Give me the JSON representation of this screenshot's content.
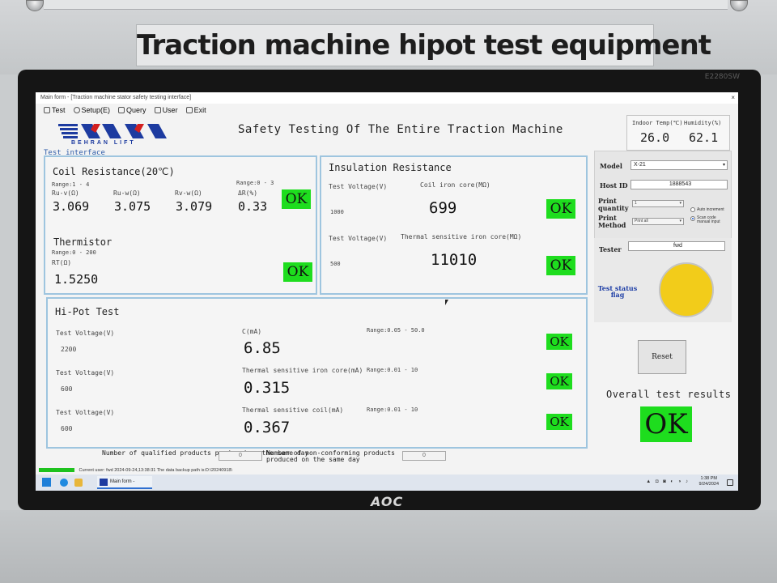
{
  "machine": {
    "title": "Traction  machine hipot  test equipment",
    "monitor_model": "E2280SW",
    "monitor_brand": "AOC"
  },
  "window": {
    "title": "Main form - [Traction machine stator safety testing interface]",
    "close_glyph": "×"
  },
  "menu": {
    "items": [
      {
        "label": "Test",
        "icon": "test-icon"
      },
      {
        "label": "Setup(E)",
        "icon": "gear-icon"
      },
      {
        "label": "Query",
        "icon": "query-icon"
      },
      {
        "label": "User",
        "icon": "user-icon"
      },
      {
        "label": "Exit",
        "icon": "exit-icon"
      }
    ]
  },
  "header": {
    "logo_sub": "BEHRAN LIFT",
    "app_title": "Safety Testing Of The Entire Traction Machine",
    "test_interface": "Test interface",
    "indoor_temp_label": "Indoor Temp(℃)",
    "indoor_temp": "26.0",
    "humidity_label": "Humidity(%)",
    "humidity": "62.1"
  },
  "coil": {
    "title": "Coil Resistance(20℃)",
    "range1": "Range:1 - 4",
    "range2": "Range:0 - 3",
    "labels": [
      "Ru-v(Ω)",
      "Ru-w(Ω)",
      "Rv-w(Ω)",
      "ΔR(%)"
    ],
    "values": [
      "3.069",
      "3.075",
      "3.079",
      "0.33"
    ],
    "result": "OK"
  },
  "thermistor": {
    "title": "Thermistor",
    "range": "Range:0 - 200",
    "label": "RT(Ω)",
    "value": "1.5250",
    "result": "OK"
  },
  "insulation": {
    "title": "Insulation Resistance",
    "rows": [
      {
        "voltage_label": "Test Voltage(V)",
        "voltage": "1000",
        "name": "Coil iron core(MΩ)",
        "value": "699",
        "result": "OK"
      },
      {
        "voltage_label": "Test Voltage(V)",
        "voltage": "500",
        "name": "Thermal sensitive iron core(MΩ)",
        "value": "11010",
        "result": "OK"
      }
    ]
  },
  "hipot": {
    "title": "Hi-Pot Test",
    "rows": [
      {
        "voltage_label": "Test Voltage(V)",
        "voltage": "2200",
        "name": "C(mA)",
        "range": "Range:0.05 - 50.0",
        "value": "6.85",
        "result": "OK"
      },
      {
        "voltage_label": "Test Voltage(V)",
        "voltage": "600",
        "name": "Thermal sensitive iron core(mA)",
        "range": "Range:0.01 - 10",
        "value": "0.315",
        "result": "OK"
      },
      {
        "voltage_label": "Test Voltage(V)",
        "voltage": "600",
        "name": "Thermal sensitive coil(mA)",
        "range": "Range:0.01 - 10",
        "value": "0.367",
        "result": "OK"
      }
    ]
  },
  "side": {
    "model_label": "Model",
    "model_value": "X-21",
    "host_label": "Host ID",
    "host_value": "1888543",
    "print_qty_label": "Print quantity",
    "print_qty_value": "1",
    "print_method_label": "Print Method",
    "print_method_value": "Print all",
    "radio1": "Auto increment",
    "radio2": "Scan code manual input",
    "tester_label": "Tester",
    "tester_value": "fwd",
    "status_label": "Test status flag",
    "status_color": "#f2cc1a",
    "reset_label": "Reset",
    "overall_label": "Overall test results",
    "overall_value": "OK"
  },
  "counts": {
    "qualified_label": "Number of qualified products produced on the same day",
    "qualified_value": "0",
    "nonconforming_label": "Number of non-conforming products produced on the same day",
    "nonconforming_value": "0"
  },
  "statusbar": {
    "text": "Current user: fwd   2024-09-24,13:38:31   The data backup path is:D:\\20240918\\"
  },
  "taskbar": {
    "task_label": "Main form - [Tracti...",
    "tray": "▲ ◘ ◙ ◐ ◑ ♪",
    "time": "1:38 PM",
    "date": "9/24/2024"
  },
  "colors": {
    "ok_green": "#1edd1e",
    "box_border": "#9ec5df",
    "brand_blue": "#1d3ba0"
  }
}
